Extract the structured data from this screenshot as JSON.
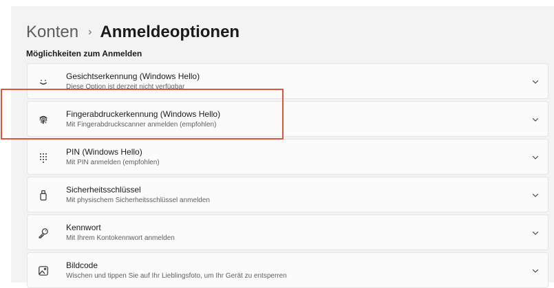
{
  "breadcrumb": {
    "parent": "Konten",
    "separator": "›",
    "current": "Anmeldeoptionen"
  },
  "section_title": "Möglichkeiten zum Anmelden",
  "options": [
    {
      "title": "Gesichtserkennung (Windows Hello)",
      "description": "Diese Option ist derzeit nicht verfügbar",
      "icon": "face-icon"
    },
    {
      "title": "Fingerabdruckerkennung (Windows Hello)",
      "description": "Mit Fingerabdruckscanner anmelden (empfohlen)",
      "icon": "fingerprint-icon"
    },
    {
      "title": "PIN (Windows Hello)",
      "description": "Mit PIN anmelden (empfohlen)",
      "icon": "pin-keypad-icon"
    },
    {
      "title": "Sicherheitsschlüssel",
      "description": "Mit physischem Sicherheitsschlüssel anmelden",
      "icon": "security-key-icon"
    },
    {
      "title": "Kennwort",
      "description": "Mit Ihrem Kontokennwort anmelden",
      "icon": "key-icon"
    },
    {
      "title": "Bildcode",
      "description": "Wischen und tippen Sie auf Ihr Lieblingsfoto, um Ihr Gerät zu entsperren",
      "icon": "picture-icon"
    }
  ],
  "colors": {
    "page_background": "#f3f3f3",
    "card_background": "#fbfbfb",
    "card_border": "#e5e5e5",
    "highlight": "#e0533b"
  }
}
